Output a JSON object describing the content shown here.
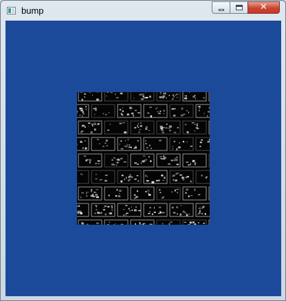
{
  "window": {
    "title": "bump",
    "icon": "app-window-icon",
    "controls": {
      "minimize_icon": "minimize-icon",
      "maximize_icon": "maximize-icon",
      "close_glyph": "✕"
    }
  },
  "viewport": {
    "background_color": "#1b4a9a",
    "texture": {
      "description_icon": "brick-bump-texture",
      "texture_color": "#000000"
    }
  }
}
